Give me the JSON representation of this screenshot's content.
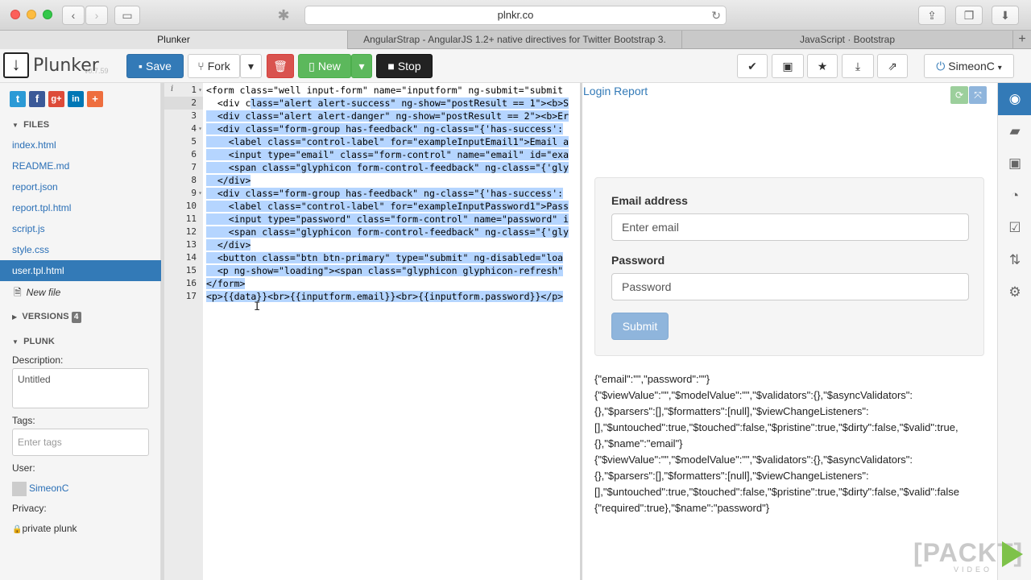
{
  "browser": {
    "url": "plnkr.co",
    "tabs": [
      {
        "label": "Plunker",
        "active": true
      },
      {
        "label": "AngularStrap - AngularJS 1.2+ native directives for Twitter Bootstrap 3.",
        "active": false
      },
      {
        "label": "JavaScript · Bootstrap",
        "active": false
      }
    ],
    "new_tab": "+"
  },
  "toolbar": {
    "logo": "Plunker",
    "version": "v0.7.59",
    "save": "Save",
    "fork": "Fork",
    "new": "New",
    "stop": "Stop",
    "user": "SimeonC"
  },
  "sidebar": {
    "files_header": "FILES",
    "files": [
      "index.html",
      "README.md",
      "report.json",
      "report.tpl.html",
      "script.js",
      "style.css",
      "user.tpl.html"
    ],
    "active_file": "user.tpl.html",
    "new_file": "New file",
    "versions_header": "VERSIONS",
    "versions_count": "4",
    "plunk_header": "PLUNK",
    "description_label": "Description:",
    "description_value": "Untitled",
    "tags_label": "Tags:",
    "tags_placeholder": "Enter tags",
    "user_label": "User:",
    "user_value": "SimeonC",
    "privacy_label": "Privacy:",
    "privacy_value": "private plunk"
  },
  "editor": {
    "active_line": 2,
    "lines": [
      "<form class=\"well input-form\" name=\"inputform\" ng-submit=\"submit",
      "  <div class=\"alert alert-success\" ng-show=\"postResult == 1\"><b>S",
      "  <div class=\"alert alert-danger\" ng-show=\"postResult == 2\"><b>Er",
      "  <div class=\"form-group has-feedback\" ng-class=\"{'has-success':",
      "    <label class=\"control-label\" for=\"exampleInputEmail1\">Email a",
      "    <input type=\"email\" class=\"form-control\" name=\"email\" id=\"exa",
      "    <span class=\"glyphicon form-control-feedback\" ng-class=\"{'gly",
      "  </div>",
      "  <div class=\"form-group has-feedback\" ng-class=\"{'has-success':",
      "    <label class=\"control-label\" for=\"exampleInputPassword1\">Pass",
      "    <input type=\"password\" class=\"form-control\" name=\"password\" i",
      "    <span class=\"glyphicon form-control-feedback\" ng-class=\"{'gly",
      "  </div>",
      "  <button class=\"btn btn-primary\" type=\"submit\" ng-disabled=\"loa",
      "  <p ng-show=\"loading\"><span class=\"glyphicon glyphicon-refresh\"",
      "</form>",
      "<p>{{data}}<br>{{inputform.email}}<br>{{inputform.password}}</p>"
    ],
    "fold_lines": [
      1,
      4,
      9
    ]
  },
  "preview": {
    "title": "Login Report",
    "email_label": "Email address",
    "email_placeholder": "Enter email",
    "password_label": "Password",
    "password_placeholder": "Password",
    "submit": "Submit",
    "output_lines": [
      "{\"email\":\"\",\"password\":\"\"}",
      "{\"$viewValue\":\"\",\"$modelValue\":\"\",\"$validators\":{},\"$asyncValidators\":",
      "{},\"$parsers\":[],\"$formatters\":[null],\"$viewChangeListeners\":",
      "[],\"$untouched\":true,\"$touched\":false,\"$pristine\":true,\"$dirty\":false,\"$valid\":true,",
      "{},\"$name\":\"email\"}",
      "{\"$viewValue\":\"\",\"$modelValue\":\"\",\"$validators\":{},\"$asyncValidators\":",
      "{},\"$parsers\":[],\"$formatters\":[null],\"$viewChangeListeners\":",
      "[],\"$untouched\":true,\"$touched\":false,\"$pristine\":true,\"$dirty\":false,\"$valid\":false",
      "{\"required\":true},\"$name\":\"password\"}"
    ]
  },
  "rail_icons": [
    "eye-icon",
    "book-icon",
    "briefcase-icon",
    "dashboard-icon",
    "check-square-icon",
    "retweet-icon",
    "gear-icon"
  ],
  "watermark": {
    "word": "[PACKT]",
    "sub": "VIDEO"
  },
  "colors": {
    "primary": "#337ab7",
    "danger": "#d9534f",
    "success": "#5cb85c",
    "selection": "#b5d5ff"
  }
}
